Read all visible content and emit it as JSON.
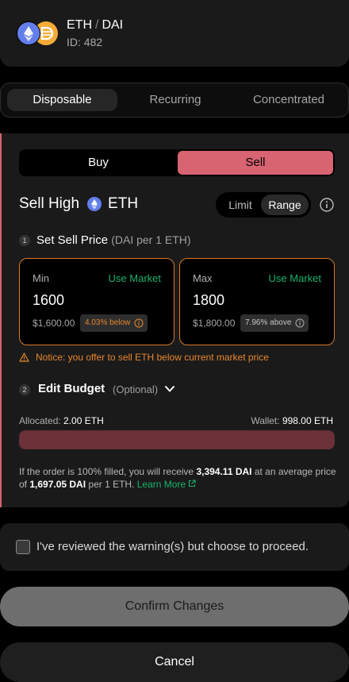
{
  "pair": {
    "base": "ETH",
    "separator": "/",
    "quote": "DAI",
    "id": "ID: 482"
  },
  "strategy_tabs": [
    {
      "label": "Disposable",
      "active": true
    },
    {
      "label": "Recurring",
      "active": false
    },
    {
      "label": "Concentrated",
      "active": false
    }
  ],
  "order": {
    "buy_label": "Buy",
    "sell_label": "Sell",
    "title_prefix": "Sell High",
    "title_token": "ETH",
    "limit_label": "Limit",
    "range_label": "Range",
    "step1_num": "1",
    "step1_label": "Set Sell Price",
    "step1_unit": "(DAI per 1 ETH)",
    "min": {
      "label": "Min",
      "market": "Use Market",
      "value": "1600",
      "usd": "$1,600.00",
      "pct": "4.03% below"
    },
    "max": {
      "label": "Max",
      "market": "Use Market",
      "value": "1800",
      "usd": "$1,800.00",
      "pct": "7.96% above"
    },
    "notice": "Notice: you offer to sell ETH below current market price",
    "step2_num": "2",
    "step2_label": "Edit Budget",
    "step2_optional": "(Optional)",
    "allocated_label": "Allocated:",
    "allocated_value": "2.00 ETH",
    "wallet_label": "Wallet:",
    "wallet_value": "998.00 ETH",
    "summary_1": "If the order is 100% filled, you will receive ",
    "summary_receive": "3,394.11 DAI",
    "summary_2": " at an average price of ",
    "summary_price": "1,697.05 DAI",
    "summary_3": " per 1 ETH. ",
    "learn_more": "Learn More"
  },
  "warning_text": "I've reviewed the warning(s) but choose to proceed.",
  "confirm_label": "Confirm Changes",
  "cancel_label": "Cancel",
  "colors": {
    "sell": "#d86371",
    "accent_green": "#19b36b",
    "warning": "#e8862e",
    "border_orange": "#d67b2a",
    "eth": "#627eea",
    "dai": "#f5ac37"
  }
}
